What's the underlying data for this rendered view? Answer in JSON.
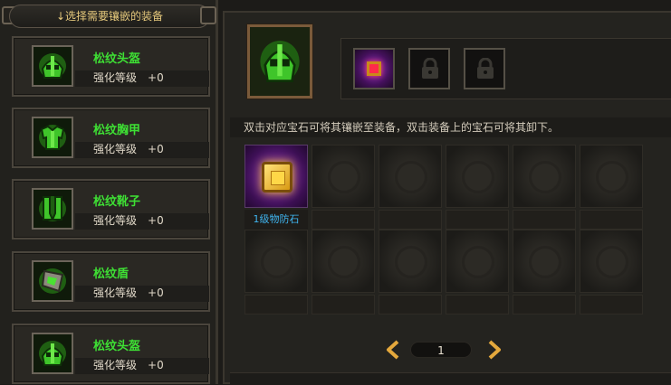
{
  "left_panel": {
    "header": "↓选择需要镶嵌的装备",
    "items": [
      {
        "name": "松纹头盔",
        "level_label": "强化等级",
        "level_value": "+0",
        "icon": "helmet-icon"
      },
      {
        "name": "松纹胸甲",
        "level_label": "强化等级",
        "level_value": "+0",
        "icon": "chest-armor-icon"
      },
      {
        "name": "松纹靴子",
        "level_label": "强化等级",
        "level_value": "+0",
        "icon": "boots-icon"
      },
      {
        "name": "松纹盾",
        "level_label": "强化等级",
        "level_value": "+0",
        "icon": "shield-icon"
      },
      {
        "name": "松纹头盔",
        "level_label": "强化等级",
        "level_value": "+0",
        "icon": "helmet-icon"
      }
    ]
  },
  "right_panel": {
    "selected_equipment_icon": "helmet-icon",
    "sockets": [
      {
        "state": "filled",
        "icon": "red-gem-icon"
      },
      {
        "state": "locked",
        "icon": "lock-icon"
      },
      {
        "state": "locked",
        "icon": "lock-icon"
      }
    ],
    "hint": "双击对应宝石可将其镶嵌至装备，双击装备上的宝石可将其卸下。",
    "gem_inventory": [
      {
        "label": "1级物防石",
        "icon": "yellow-gem-icon"
      }
    ],
    "page": "1"
  },
  "colors": {
    "item_name": "#3ee034",
    "gem_label": "#3fb4ef",
    "header_text": "#e6c97c",
    "arrow": "#e4a83c"
  }
}
